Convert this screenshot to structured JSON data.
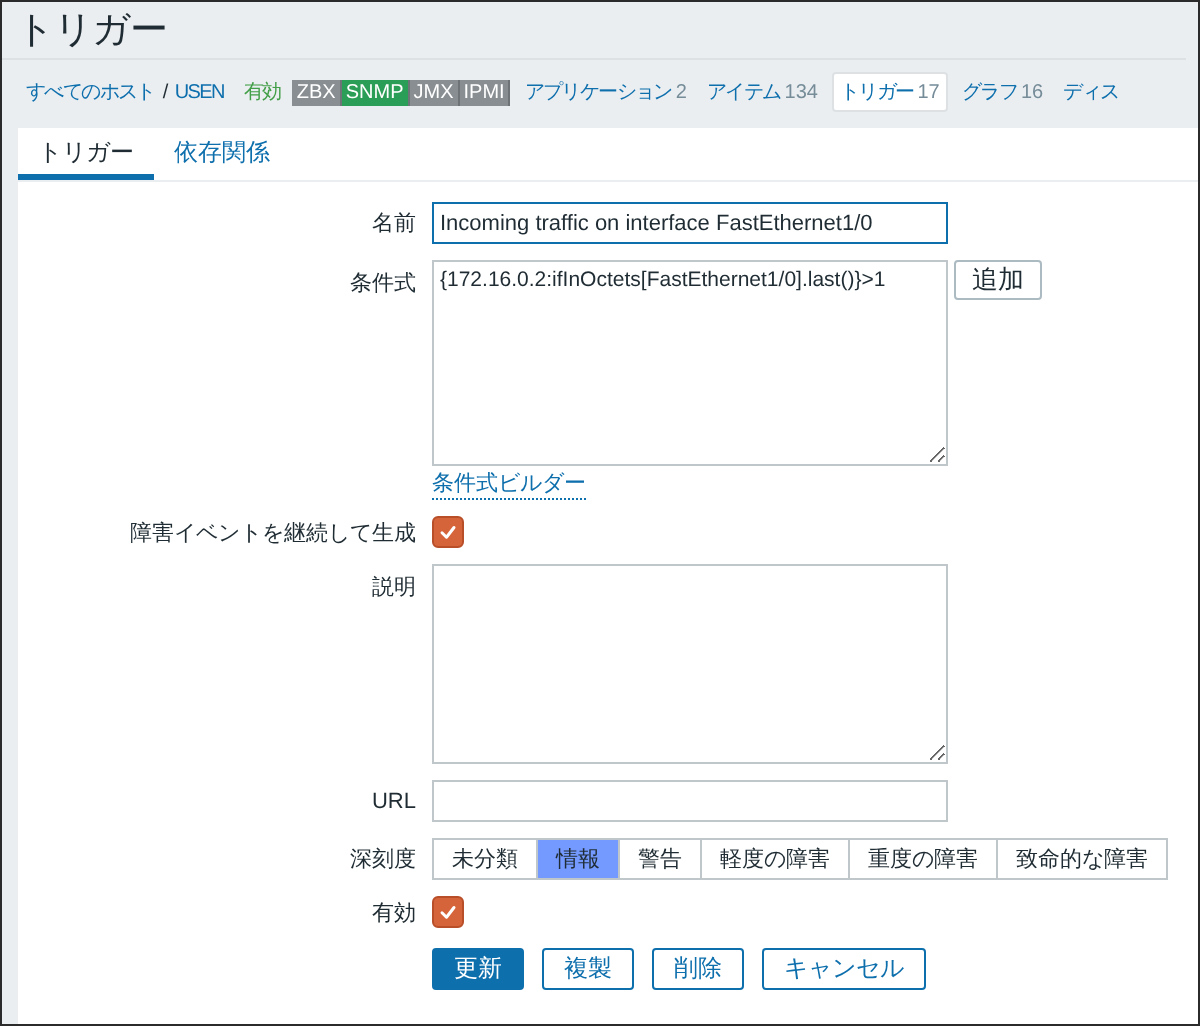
{
  "page": {
    "title": "トリガー"
  },
  "host_nav": {
    "host_list": "すべてのホスト",
    "separator": "/",
    "host": "USEN",
    "status": "有効",
    "interfaces": [
      {
        "label": "ZBX",
        "available": false
      },
      {
        "label": "SNMP",
        "available": true
      },
      {
        "label": "JMX",
        "available": false
      },
      {
        "label": "IPMI",
        "available": false
      }
    ],
    "links": [
      {
        "label": "アプリケーション",
        "count": "2",
        "selected": false
      },
      {
        "label": "アイテム",
        "count": "134",
        "selected": false
      },
      {
        "label": "トリガー",
        "count": "17",
        "selected": true
      },
      {
        "label": "グラフ",
        "count": "16",
        "selected": false
      },
      {
        "label": "ディス",
        "selected": false
      }
    ]
  },
  "tabs": [
    {
      "label": "トリガー",
      "selected": true
    },
    {
      "label": "依存関係",
      "selected": false
    }
  ],
  "form": {
    "name": {
      "label": "名前",
      "value": "Incoming traffic on interface FastEthernet1/0"
    },
    "expression": {
      "label": "条件式",
      "value": "{172.16.0.2:ifInOctets[FastEthernet1/0].last()}>1",
      "button": "追加",
      "builder_link": "条件式ビルダー"
    },
    "multiple_events": {
      "label": "障害イベントを継続して生成",
      "checked": true
    },
    "description": {
      "label": "説明"
    },
    "url": {
      "label": "URL"
    },
    "severity": {
      "label": "深刻度",
      "options": [
        {
          "label": "未分類",
          "selected": false
        },
        {
          "label": "情報",
          "selected": true
        },
        {
          "label": "警告",
          "selected": false
        },
        {
          "label": "軽度の障害",
          "selected": false
        },
        {
          "label": "重度の障害",
          "selected": false
        },
        {
          "label": "致命的な障害",
          "selected": false
        }
      ]
    },
    "enabled": {
      "label": "有効",
      "checked": true
    }
  },
  "buttons": [
    {
      "label": "更新",
      "kind": "primary"
    },
    {
      "label": "複製",
      "kind": "secondary"
    },
    {
      "label": "削除",
      "kind": "secondary"
    },
    {
      "label": "キャンセル",
      "kind": "secondary"
    }
  ]
}
